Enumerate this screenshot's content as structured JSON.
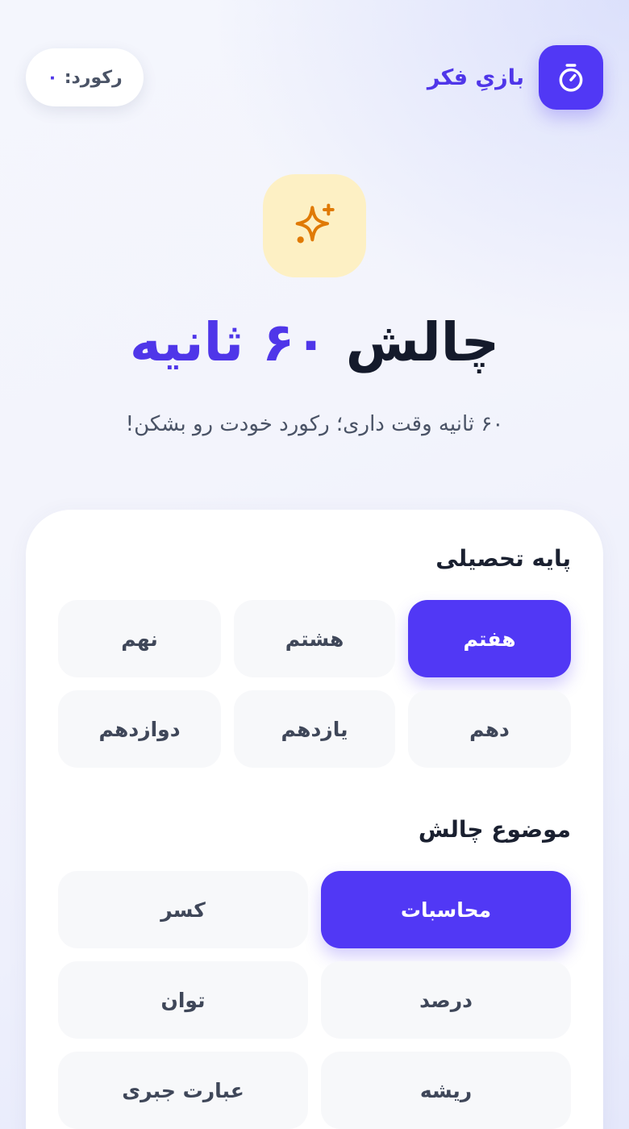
{
  "header": {
    "brand_title": "بازیِ فکر",
    "brand_icon": "stopwatch-icon",
    "record_label": "رکورد:",
    "record_value": "۰"
  },
  "hero": {
    "icon": "sparkles-icon",
    "title_main": "چالش",
    "title_accent": "۶۰ ثانیه",
    "subtitle": "۶۰ ثانیه وقت داری؛ رکورد خودت رو بشکن!"
  },
  "grade_section": {
    "title": "پایه تحصیلی",
    "options": [
      {
        "label": "هفتم",
        "selected": true
      },
      {
        "label": "هشتم",
        "selected": false
      },
      {
        "label": "نهم",
        "selected": false
      },
      {
        "label": "دهم",
        "selected": false
      },
      {
        "label": "یازدهم",
        "selected": false
      },
      {
        "label": "دوازدهم",
        "selected": false
      }
    ]
  },
  "topic_section": {
    "title": "موضوع چالش",
    "options": [
      {
        "label": "محاسبات",
        "selected": true
      },
      {
        "label": "کسر",
        "selected": false
      },
      {
        "label": "درصد",
        "selected": false
      },
      {
        "label": "توان",
        "selected": false
      },
      {
        "label": "ریشه",
        "selected": false
      },
      {
        "label": "عبارت جبری",
        "selected": false
      }
    ]
  },
  "colors": {
    "accent": "#5138f5",
    "hero_icon_bg": "#fdf0c4",
    "hero_icon_fg": "#e07a06"
  }
}
